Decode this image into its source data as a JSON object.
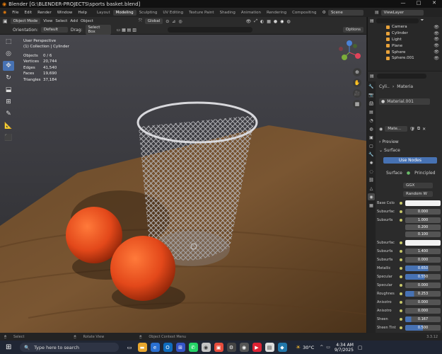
{
  "window": {
    "title": "Blender [G:\\BLENDER-PROJECTS\\sports basket.blend]",
    "minimize": "—",
    "maximize": "□",
    "close": "✕"
  },
  "menu": {
    "items": [
      "File",
      "Edit",
      "Render",
      "Window",
      "Help"
    ],
    "workspaces": [
      "Layout",
      "Modeling",
      "Sculpting",
      "UV Editing",
      "Texture Paint",
      "Shading",
      "Animation",
      "Rendering",
      "Compositing"
    ],
    "active_workspace": "Modeling",
    "scene": "Scene",
    "view_layer": "ViewLayer"
  },
  "header": {
    "mode": "Object Mode",
    "menus": [
      "View",
      "Select",
      "Add",
      "Object"
    ],
    "transform": "Global",
    "options": "Options"
  },
  "tool_options": {
    "orientation_label": "Orientation:",
    "orientation_value": "Default",
    "drag_label": "Drag:",
    "drag_value": "Select Box"
  },
  "viewport": {
    "view_name": "User Perspective",
    "collection": "(1) Collection | Cylinder",
    "stats": [
      {
        "k": "Objects",
        "v": "0 / 6"
      },
      {
        "k": "Vertices",
        "v": "20,744"
      },
      {
        "k": "Edges",
        "v": "41,540"
      },
      {
        "k": "Faces",
        "v": "19,690"
      },
      {
        "k": "Triangles",
        "v": "37,184"
      }
    ]
  },
  "outliner": {
    "items": [
      "Camera",
      "Cylinder",
      "Light",
      "Plane",
      "Sphere",
      "Sphere.001"
    ]
  },
  "properties": {
    "object_name": "Cyli..",
    "material_tab": "Materia",
    "slot": "Material.001",
    "material_short": "Mate...",
    "sections": [
      "Preview",
      "Surface"
    ],
    "use_nodes": "Use Nodes",
    "surface_label": "Surface",
    "surface_value": "Principled",
    "distribution": "GGX",
    "subsurface_method": "Random W",
    "rows": [
      {
        "label": "Base Colo",
        "value": ""
      },
      {
        "label": "Subsurfac",
        "value": "0.000"
      },
      {
        "label": "Subsurfa",
        "value": "1.000"
      },
      {
        "label": "",
        "value": "0.200"
      },
      {
        "label": "",
        "value": "0.100"
      },
      {
        "label": "Subsurfac",
        "value": ""
      },
      {
        "label": "Subsurfa",
        "value": "1.400"
      },
      {
        "label": "Subsurfa",
        "value": "0.000"
      },
      {
        "label": "Metallic",
        "value": "0.650"
      },
      {
        "label": "Specular",
        "value": "0.550"
      },
      {
        "label": "Specular",
        "value": "0.000"
      },
      {
        "label": "Roughnes",
        "value": "0.253"
      },
      {
        "label": "Anisotro",
        "value": "0.000"
      },
      {
        "label": "Anisotro",
        "value": "0.000"
      },
      {
        "label": "Sheen",
        "value": "0.167"
      },
      {
        "label": "Sheen Tint",
        "value": "0.500"
      }
    ]
  },
  "statusbar": {
    "select": "Select",
    "rotate": "Rotate View",
    "context": "Object Context Menu",
    "version": "3.3.12"
  },
  "taskbar": {
    "search": "Type here to search",
    "temp": "30°C",
    "time": "4:34 AM",
    "date": "9/7/2025"
  }
}
